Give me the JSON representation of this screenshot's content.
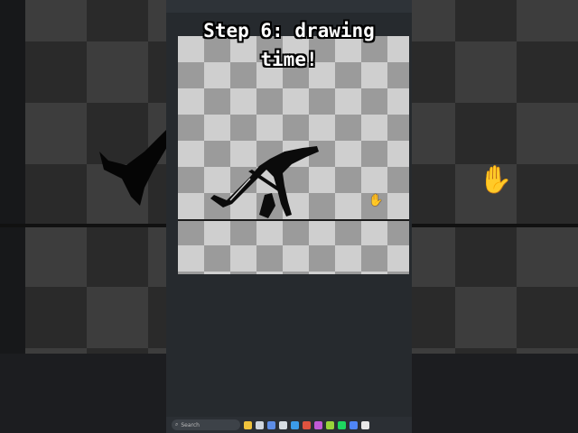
{
  "caption": {
    "line1": "Step 6: drawing",
    "line2": "time!"
  },
  "taskbar": {
    "search_placeholder": "Search",
    "icons": [
      "folder-icon",
      "file-explorer-icon",
      "mail-icon",
      "settings-icon",
      "browser-icon",
      "photo-icon",
      "paint-icon",
      "app-icon",
      "spotify-icon",
      "chrome-icon",
      "notes-icon"
    ]
  },
  "colors": {
    "panel_bg": "#262a2e",
    "checker_light": "#cfcfcf",
    "checker_dark": "#9b9b9b",
    "caption_text": "#ffffff"
  }
}
